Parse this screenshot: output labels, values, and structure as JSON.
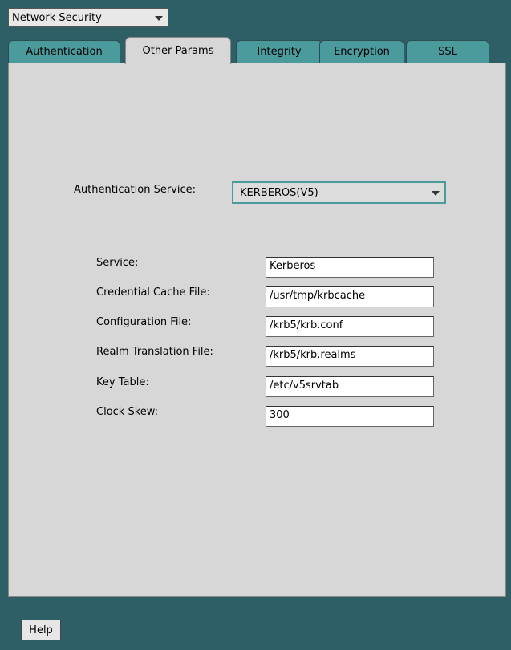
{
  "category_select": {
    "value": "Network Security"
  },
  "tabs": [
    {
      "label": "Authentication"
    },
    {
      "label": "Other Params"
    },
    {
      "label": "Integrity"
    },
    {
      "label": "Encryption"
    },
    {
      "label": "SSL"
    }
  ],
  "active_tab": "Other Params",
  "auth_service": {
    "label": "Authentication Service:",
    "value": "KERBEROS(V5)"
  },
  "fields": [
    {
      "label": "Service:",
      "value": "Kerberos"
    },
    {
      "label": "Credential Cache File:",
      "value": "/usr/tmp/krbcache"
    },
    {
      "label": "Configuration File:",
      "value": "/krb5/krb.conf"
    },
    {
      "label": "Realm Translation File:",
      "value": "/krb5/krb.realms"
    },
    {
      "label": "Key Table:",
      "value": "/etc/v5srvtab"
    },
    {
      "label": "Clock Skew:",
      "value": "300"
    }
  ],
  "help_button": {
    "label": "Help"
  },
  "colors": {
    "background": "#2f5f66",
    "tab": "#4b9a9c",
    "panel": "#d7d7d7"
  }
}
